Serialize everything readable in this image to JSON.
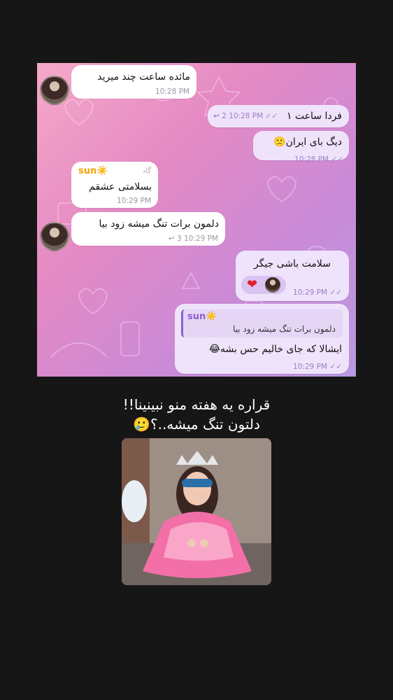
{
  "messages": [
    {
      "id": "m1",
      "text": "مائده ساعت چند میرید",
      "time": "10:28 PM"
    },
    {
      "id": "m2",
      "text": "فردا ساعت ۱",
      "time": "10:28 PM",
      "replies": "2",
      "check": "✓✓"
    },
    {
      "id": "m3",
      "text": "دیگ بای ایران🙁",
      "time": "10:28 PM",
      "check": "✓✓"
    },
    {
      "id": "m4",
      "name": "sun☀️",
      "tag": "گاد",
      "text": "بسلامتی عشقم",
      "time": "10:29 PM"
    },
    {
      "id": "m5",
      "text": "دلمون برات تنگ میشه زود بیا",
      "time": "10:29 PM",
      "replies": "3"
    },
    {
      "id": "m6",
      "text": "سلامت باشی جیگر",
      "time": "10:29 PM",
      "check": "✓✓",
      "reaction": "❤"
    },
    {
      "id": "m7",
      "quote_name": "sun☀️",
      "quote_text": "دلمون برات تنگ میشه زود بیا",
      "text": "ایشالا که جای خالیم حس بشه😂",
      "time": "10:29 PM",
      "check": "✓✓"
    }
  ],
  "story": {
    "line1": "قراره یه هفته منو نبینینا!!",
    "line2": "دلتون تنگ میشه..؟🥲"
  },
  "colors": {
    "accent": "#8a5fd0",
    "name": "#f0a500",
    "background": "#161616"
  }
}
